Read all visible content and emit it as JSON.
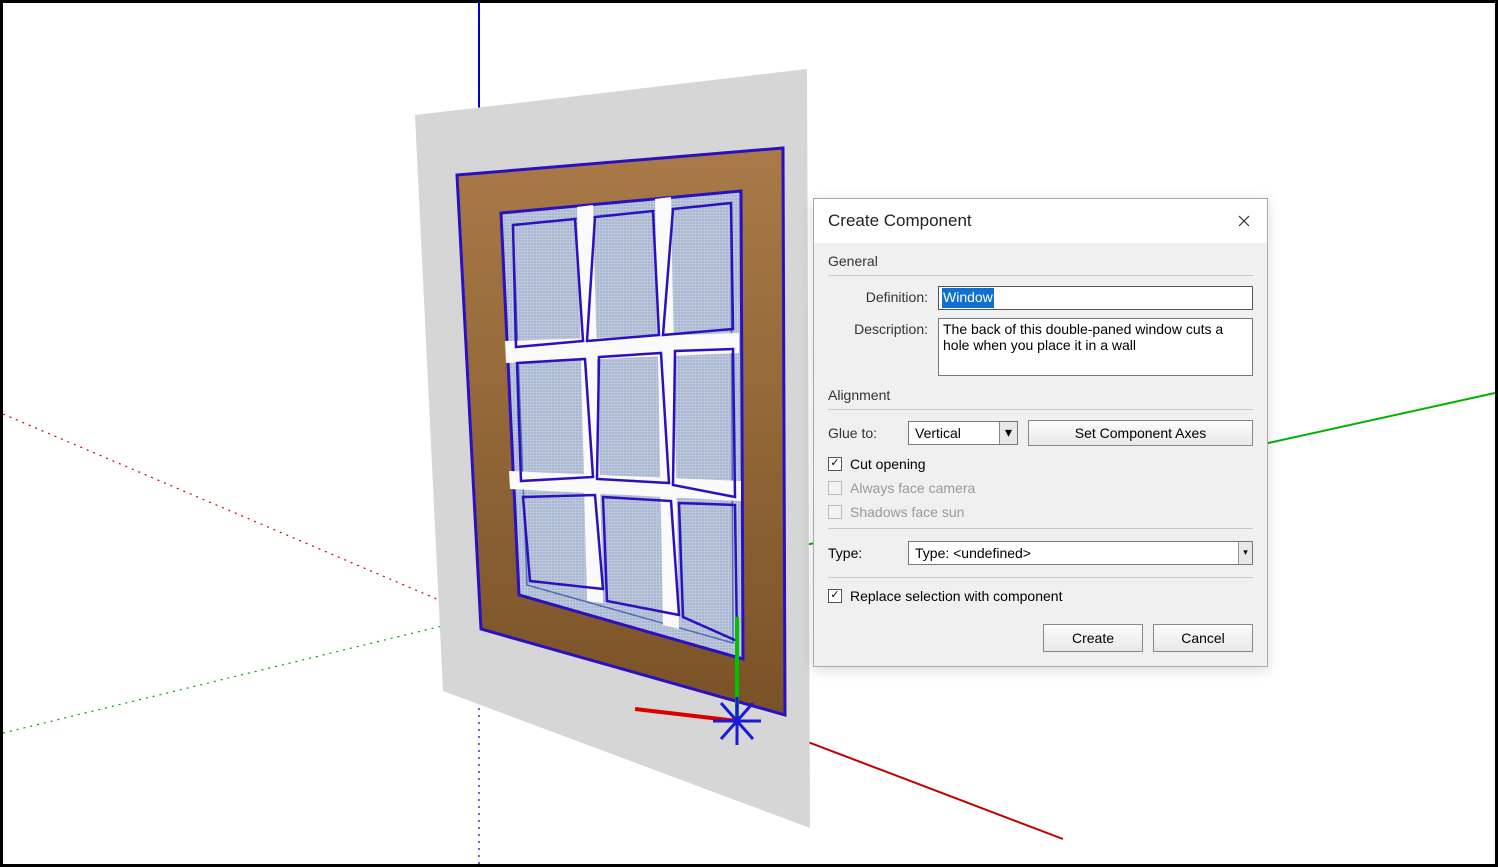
{
  "dialog": {
    "title": "Create Component",
    "general_section": "General",
    "definition_label": "Definition:",
    "definition_value": "Window",
    "description_label": "Description:",
    "description_value": "The back of this double-paned window cuts a hole when you place it in a wall",
    "alignment_section": "Alignment",
    "glue_label": "Glue to:",
    "glue_value": "Vertical",
    "axes_button": "Set Component Axes",
    "cut_opening_label": "Cut opening",
    "cut_opening_checked": true,
    "always_face_label": "Always face camera",
    "shadows_face_label": "Shadows face sun",
    "type_label": "Type:",
    "type_value": "Type: <undefined>",
    "replace_label": "Replace selection with component",
    "replace_checked": true,
    "create_btn": "Create",
    "cancel_btn": "Cancel"
  }
}
